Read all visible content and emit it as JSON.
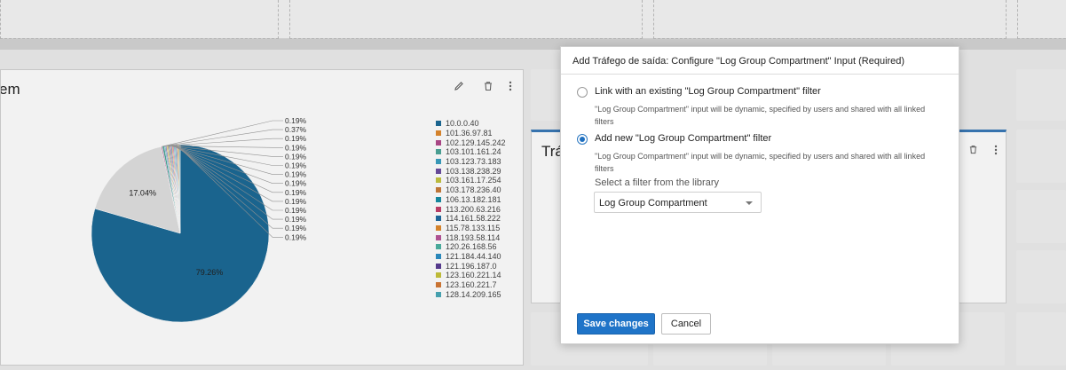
{
  "background": {
    "widget_title": "em",
    "widget2_title": "Trá",
    "icons": [
      "pencil-icon",
      "trash-icon",
      "kebab-icon"
    ]
  },
  "modal": {
    "title": "Add Tráfego de saída: Configure \"Log Group Compartment\" Input (Required)",
    "option_existing": {
      "label": "Link with an existing \"Log Group Compartment\" filter",
      "help": "\"Log Group Compartment\" input will be dynamic, specified by users and shared with all linked filters",
      "selected": false
    },
    "option_new": {
      "label": "Add new \"Log Group Compartment\" filter",
      "help": "\"Log Group Compartment\" input will be dynamic, specified by users and shared with all linked filters",
      "selected": true
    },
    "select_label": "Select a filter from the library",
    "select_value": "Log Group Compartment",
    "save_label": "Save changes",
    "cancel_label": "Cancel",
    "accent_color": "#1f74c8"
  },
  "chart_data": {
    "type": "pie",
    "slices": [
      {
        "label": "10.0.0.40",
        "value": 79.26,
        "color": "#1c6a96"
      },
      {
        "label": "101.36.97.81",
        "value": 17.04,
        "color": "#e0e0e0"
      },
      {
        "label": "102.129.145.242",
        "value": 0.19,
        "color": "#b14a8c"
      },
      {
        "label": "103.101.161.24",
        "value": 0.37,
        "color": "#4fa79a"
      },
      {
        "label": "103.123.73.183",
        "value": 0.19,
        "color": "#3aa0c0"
      },
      {
        "label": "103.138.238.29",
        "value": 0.19,
        "color": "#6b4da0"
      },
      {
        "label": "103.161.17.254",
        "value": 0.19,
        "color": "#c4c441"
      },
      {
        "label": "103.178.236.40",
        "value": 0.19,
        "color": "#c97c3a"
      },
      {
        "label": "106.13.182.181",
        "value": 0.19,
        "color": "#178ea5"
      },
      {
        "label": "113.200.63.216",
        "value": 0.19,
        "color": "#c2406a"
      },
      {
        "label": "114.161.58.222",
        "value": 0.19,
        "color": "#1f6aa0"
      },
      {
        "label": "115.78.133.115",
        "value": 0.19,
        "color": "#e08a2e"
      },
      {
        "label": "118.193.58.114",
        "value": 0.19,
        "color": "#b8569a"
      },
      {
        "label": "120.26.168.56",
        "value": 0.19,
        "color": "#4db3a3"
      },
      {
        "label": "121.184.44.140",
        "value": 0.19,
        "color": "#2d8fc4"
      },
      {
        "label": "121.196.187.0",
        "value": 0.19,
        "color": "#5a3e94"
      },
      {
        "label": "123.160.221.14",
        "value": 0.19,
        "color": "#c8c43c"
      },
      {
        "label": "123.160.221.7",
        "value": 0.19,
        "color": "#d47a36"
      },
      {
        "label": "128.14.209.165",
        "value": 0.19,
        "color": "#4aa9b8"
      }
    ],
    "legend_labels": [
      "10.0.0.40",
      "101.36.97.81",
      "102.129.145.242",
      "103.101.161.24",
      "103.123.73.183",
      "103.138.238.29",
      "103.161.17.254",
      "103.178.236.40",
      "106.13.182.181",
      "113.200.63.216",
      "114.161.58.222",
      "115.78.133.115",
      "118.193.58.114",
      "120.26.168.56",
      "121.184.44.140",
      "121.196.187.0",
      "123.160.221.14",
      "123.160.221.7",
      "128.14.209.165"
    ],
    "legend_colors": [
      "#1c6a96",
      "#e08a2e",
      "#b14a8c",
      "#4fa79a",
      "#3aa0c0",
      "#6b4da0",
      "#c4c441",
      "#c97c3a",
      "#178ea5",
      "#c2406a",
      "#1f6aa0",
      "#e08a2e",
      "#b8569a",
      "#4db3a3",
      "#2d8fc4",
      "#5a3e94",
      "#c8c43c",
      "#d47a36",
      "#4aa9b8"
    ],
    "data_labels": [
      "79.26%",
      "17.04%",
      "0.19%",
      "0.37%",
      "0.19%",
      "0.19%",
      "0.19%",
      "0.19%",
      "0.19%",
      "0.19%",
      "0.19%",
      "0.19%",
      "0.19%",
      "0.19%",
      "0.19%",
      "0.19%"
    ],
    "legend_placement": "right"
  }
}
